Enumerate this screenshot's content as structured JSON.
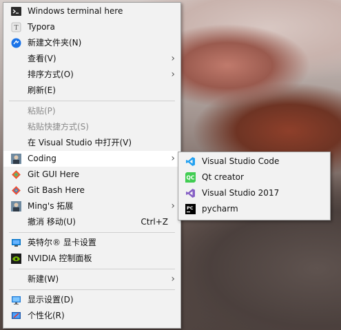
{
  "main_menu": {
    "group1": [
      {
        "label": "Windows terminal here",
        "icon": "terminal-icon"
      },
      {
        "label": "Typora",
        "icon": "typora-icon"
      },
      {
        "label": "新建文件夹(N)",
        "icon": "new-folder-icon"
      }
    ],
    "group2": [
      {
        "label": "查看(V)",
        "has_submenu": true
      },
      {
        "label": "排序方式(O)",
        "has_submenu": true
      },
      {
        "label": "刷新(E)"
      }
    ],
    "group3": [
      {
        "label": "粘贴(P)",
        "disabled": true
      },
      {
        "label": "粘贴快捷方式(S)",
        "disabled": true
      },
      {
        "label": "在 Visual Studio 中打开(V)"
      },
      {
        "label": "Coding",
        "icon": "coding-avatar-icon",
        "has_submenu": true,
        "highlighted": true
      },
      {
        "label": "Git GUI Here",
        "icon": "git-gui-icon"
      },
      {
        "label": "Git Bash Here",
        "icon": "git-bash-icon"
      },
      {
        "label": "Ming's 拓展",
        "icon": "ming-avatar-icon",
        "has_submenu": true
      },
      {
        "label": "撤消 移动(U)",
        "shortcut": "Ctrl+Z"
      }
    ],
    "group4": [
      {
        "label": "英特尔® 显卡设置",
        "icon": "intel-graphics-icon"
      },
      {
        "label": "NVIDIA 控制面板",
        "icon": "nvidia-icon"
      }
    ],
    "group5": [
      {
        "label": "新建(W)",
        "has_submenu": true
      }
    ],
    "group6": [
      {
        "label": "显示设置(D)",
        "icon": "display-settings-icon"
      },
      {
        "label": "个性化(R)",
        "icon": "personalize-icon"
      }
    ]
  },
  "submenu": {
    "items": [
      {
        "label": "Visual Studio Code",
        "icon": "vscode-icon"
      },
      {
        "label": "Qt creator",
        "icon": "qt-creator-icon"
      },
      {
        "label": "Visual Studio 2017",
        "icon": "visual-studio-icon"
      },
      {
        "label": "pycharm",
        "icon": "pycharm-icon"
      }
    ]
  },
  "colors": {
    "menu_bg": "#f2f2f2",
    "highlight_bg": "#ffffff",
    "disabled_text": "#8a8a8a",
    "vscode_blue": "#23a1f1",
    "qt_green": "#41cd52",
    "vs_purple": "#865fc5",
    "nvidia_green": "#76b900"
  }
}
